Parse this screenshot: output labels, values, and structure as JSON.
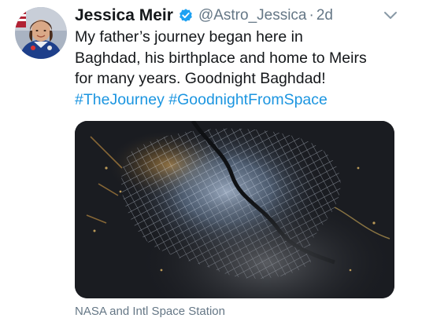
{
  "tweet": {
    "author": {
      "display_name": "Jessica Meir",
      "handle": "@Astro_Jessica",
      "verified_icon": "verified-badge-icon",
      "avatar_icon": "astronaut-portrait"
    },
    "separator": "·",
    "timestamp": "2d",
    "menu_icon": "chevron-down-icon",
    "text_lines": [
      "My father’s journey began here in",
      "Baghdad, his birthplace and home to Meirs",
      "for many years. Goodnight Baghdad!"
    ],
    "hashtags": [
      "#TheJourney",
      "#GoodnightFromSpace"
    ],
    "media": {
      "type": "photo",
      "subject": "night-city-lights-from-orbit"
    },
    "media_caption": "NASA and Intl Space Station"
  },
  "colors": {
    "text_primary": "#14171a",
    "text_secondary": "#657786",
    "link": "#1b95e0",
    "verified": "#1da1f2",
    "background": "#ffffff"
  }
}
